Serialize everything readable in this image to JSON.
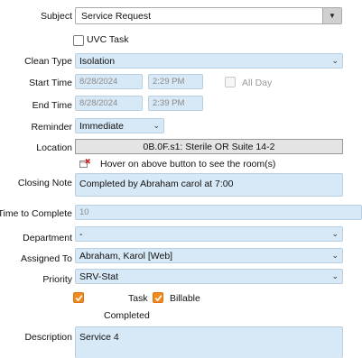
{
  "subject": {
    "label": "Subject",
    "value": "Service Request"
  },
  "uvc_task": {
    "label": "UVC Task",
    "checked": false
  },
  "clean_type": {
    "label": "Clean Type",
    "value": "Isolation"
  },
  "start_time": {
    "label": "Start Time",
    "date": "8/28/2024",
    "time": "2:29 PM"
  },
  "all_day": {
    "label": "All Day",
    "checked": false
  },
  "end_time": {
    "label": "End Time",
    "date": "8/28/2024",
    "time": "2:39 PM"
  },
  "reminder": {
    "label": "Reminder",
    "value": "Immediate"
  },
  "location": {
    "label": "Location",
    "value": "0B.0F.s1: Sterile OR Suite 14-2",
    "hint": "Hover on above button to see the room(s)"
  },
  "closing_note": {
    "label": "Closing Note",
    "value": "Completed by Abraham carol at 7:00"
  },
  "time_to_complete": {
    "label": "Time to Complete",
    "value": "10"
  },
  "department": {
    "label": "Department",
    "value": "-"
  },
  "assigned_to": {
    "label": "Assigned To",
    "value": "Abraham, Karol [Web]"
  },
  "priority": {
    "label": "Priority",
    "value": "SRV-Stat"
  },
  "task_completed": {
    "label_line1": "Task",
    "label_line2": "Completed",
    "checked": true
  },
  "billable": {
    "label": "Billable",
    "checked": true
  },
  "description": {
    "label": "Description",
    "value": "Service 4"
  },
  "colors": {
    "field_bg": "#d7e9f7",
    "checkbox_orange": "#f08a1c",
    "location_bg": "#e4e4e4"
  }
}
